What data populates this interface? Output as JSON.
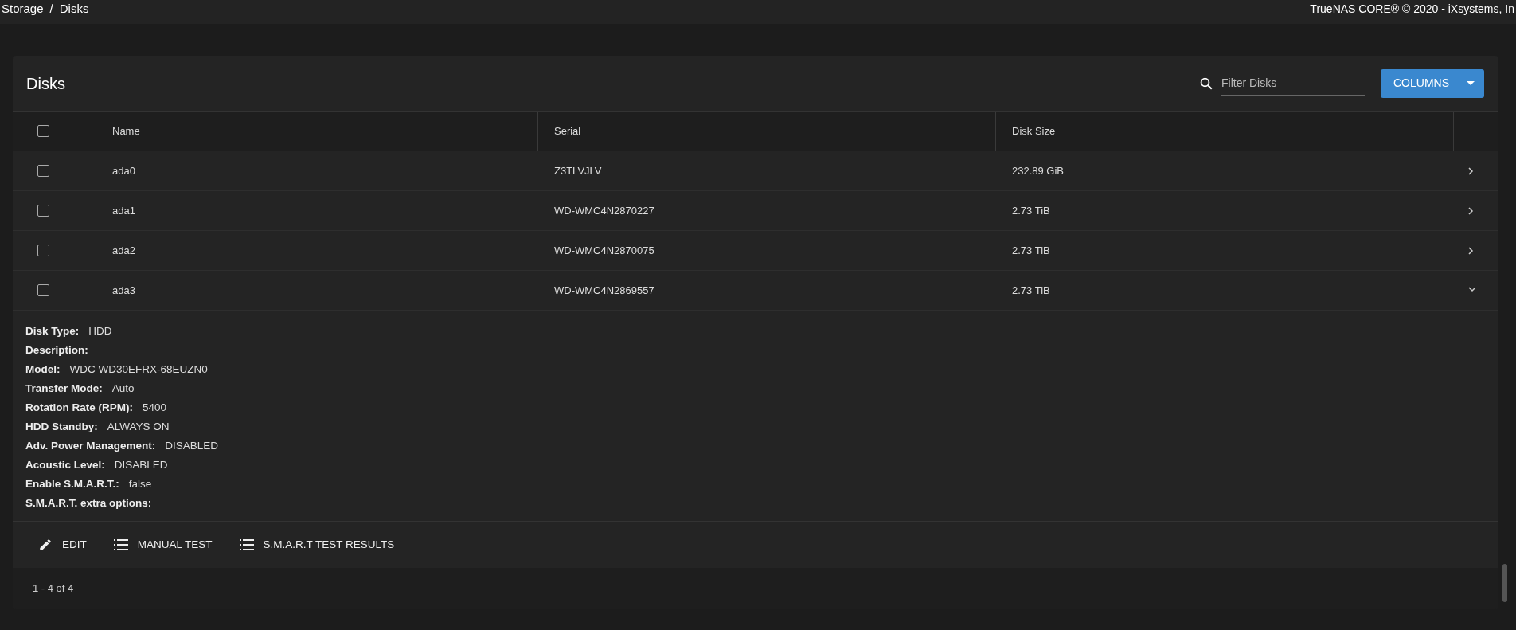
{
  "topbar": {
    "breadcrumb": [
      "Storage",
      "Disks"
    ],
    "separator": "/",
    "copyright": "TrueNAS CORE® © 2020 - iXsystems, In"
  },
  "card": {
    "title": "Disks",
    "filter": {
      "placeholder": "Filter Disks"
    },
    "columns_button": "COLUMNS",
    "table": {
      "select_all_checked": false,
      "columns": [
        "Name",
        "Serial",
        "Disk Size"
      ],
      "rows": [
        {
          "name": "ada0",
          "serial": "Z3TLVJLV",
          "size": "232.89 GiB",
          "checked": false,
          "expanded": false
        },
        {
          "name": "ada1",
          "serial": "WD-WMC4N2870227",
          "size": "2.73 TiB",
          "checked": false,
          "expanded": false
        },
        {
          "name": "ada2",
          "serial": "WD-WMC4N2870075",
          "size": "2.73 TiB",
          "checked": false,
          "expanded": false
        },
        {
          "name": "ada3",
          "serial": "WD-WMC4N2869557",
          "size": "2.73 TiB",
          "checked": false,
          "expanded": true
        }
      ]
    },
    "details": [
      {
        "label": "Disk Type:",
        "value": "HDD"
      },
      {
        "label": "Description:"
      },
      {
        "label": "Model:",
        "value": "WDC WD30EFRX-68EUZN0"
      },
      {
        "label": "Transfer Mode:",
        "value": "Auto"
      },
      {
        "label": "Rotation Rate (RPM):",
        "value": "5400"
      },
      {
        "label": "HDD Standby:",
        "value": "ALWAYS ON"
      },
      {
        "label": "Adv. Power Management:",
        "value": "DISABLED"
      },
      {
        "label": "Acoustic Level:",
        "value": "DISABLED"
      },
      {
        "label": "Enable S.M.A.R.T.:",
        "value": "false"
      },
      {
        "label": "S.M.A.R.T. extra options:"
      }
    ],
    "actions": [
      {
        "label": "EDIT",
        "kind": "edit"
      },
      {
        "label": "MANUAL TEST",
        "kind": "list"
      },
      {
        "label": "S.M.A.R.T TEST RESULTS",
        "kind": "list"
      }
    ],
    "paginator": "1 - 4 of 4"
  }
}
